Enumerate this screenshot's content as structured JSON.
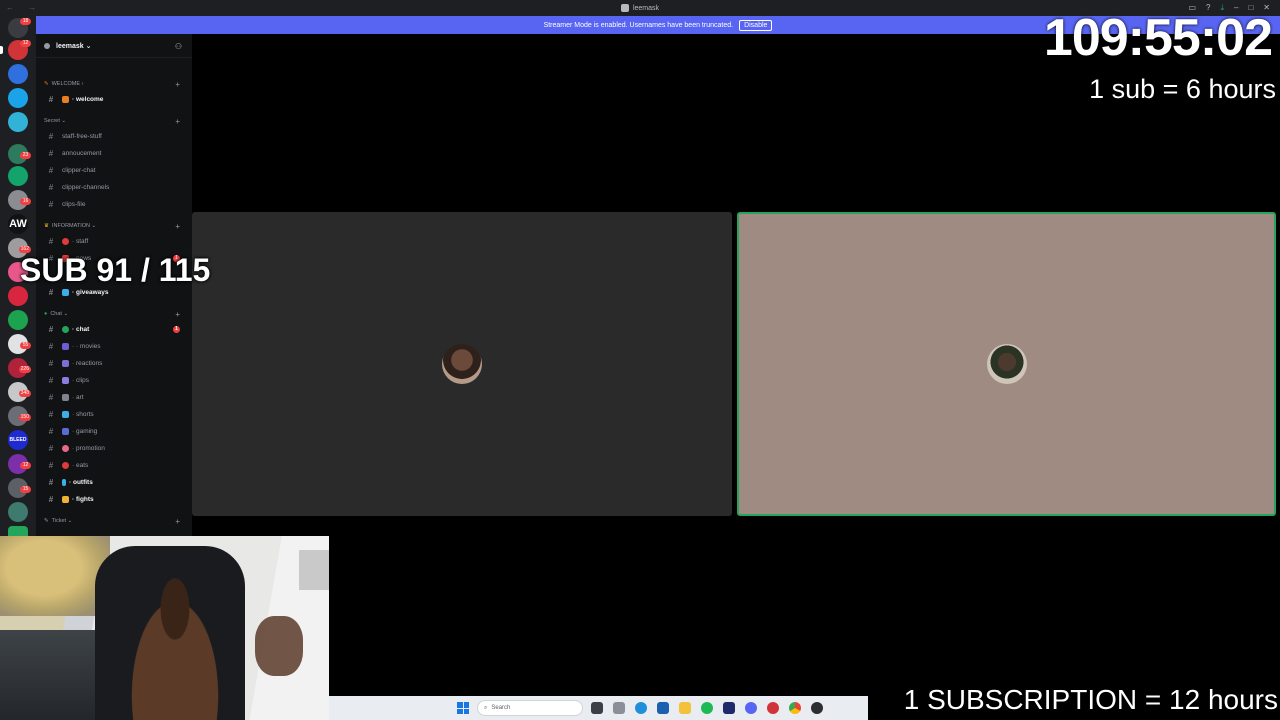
{
  "window": {
    "title": "leemask",
    "nav_arrows": "← →"
  },
  "banner": {
    "text": "Streamer Mode is enabled. Usernames have been truncated.",
    "disable_label": "Disable"
  },
  "server": {
    "name": "leemask ⌄"
  },
  "categories": {
    "welcome": "WELCOME ›",
    "secret": "Secret ⌄",
    "information": "INFORMATION ⌄",
    "chat": "Chat ⌄",
    "ticket": "Ticket ⌄"
  },
  "channels": {
    "welcome": "· welcome",
    "staff_free_stuff": "staff-free-stuff",
    "annoucement": "annoucement",
    "clipper_chat": "clipper-chat",
    "clipper_channels": "clipper-channels",
    "clips_file": "clips-file",
    "staff": "· staff",
    "news": "· news",
    "giveaways": "· giveaways",
    "chat": "· chat",
    "movies": "· · movies",
    "reactions": "· reactions",
    "clips": "· clips",
    "art": "· art",
    "shorts": "· shorts",
    "gaming": "· gaming",
    "promotion": "· promotion",
    "eats": "· eats",
    "outfits": "· outfits",
    "fights": "· fights"
  },
  "rail_badges": [
    "18",
    "12",
    "23",
    "16",
    "162",
    "55",
    "226",
    "348",
    "150",
    "12",
    "15"
  ],
  "mention_count": "1",
  "overlay": {
    "timer": "109:55:02",
    "sub_rate": "1 sub = 6 hours",
    "sub_count": "SUB 91 / 115",
    "subscription_rate": "1 SUBSCRIPTION = 12 hours"
  },
  "taskbar": {
    "search_placeholder": "Search"
  },
  "colors": {
    "blurple": "#5865f2",
    "speaking_border": "#23a55a",
    "mention_red": "#f23f42"
  }
}
